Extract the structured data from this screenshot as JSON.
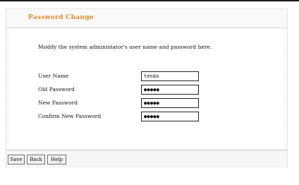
{
  "title": "Password Change",
  "description": "Modify the system administator's user name and password here.",
  "form": {
    "user_name": {
      "label": "User Name",
      "value": "tenda"
    },
    "old_password": {
      "label": "Old Password",
      "value": "●●●●●"
    },
    "new_password": {
      "label": "New Password",
      "value": "●●●●●"
    },
    "confirm_password": {
      "label": "Confirm New Password",
      "value": "●●●●●"
    }
  },
  "buttons": {
    "save": "Save",
    "back": "Back",
    "help": "Help"
  }
}
